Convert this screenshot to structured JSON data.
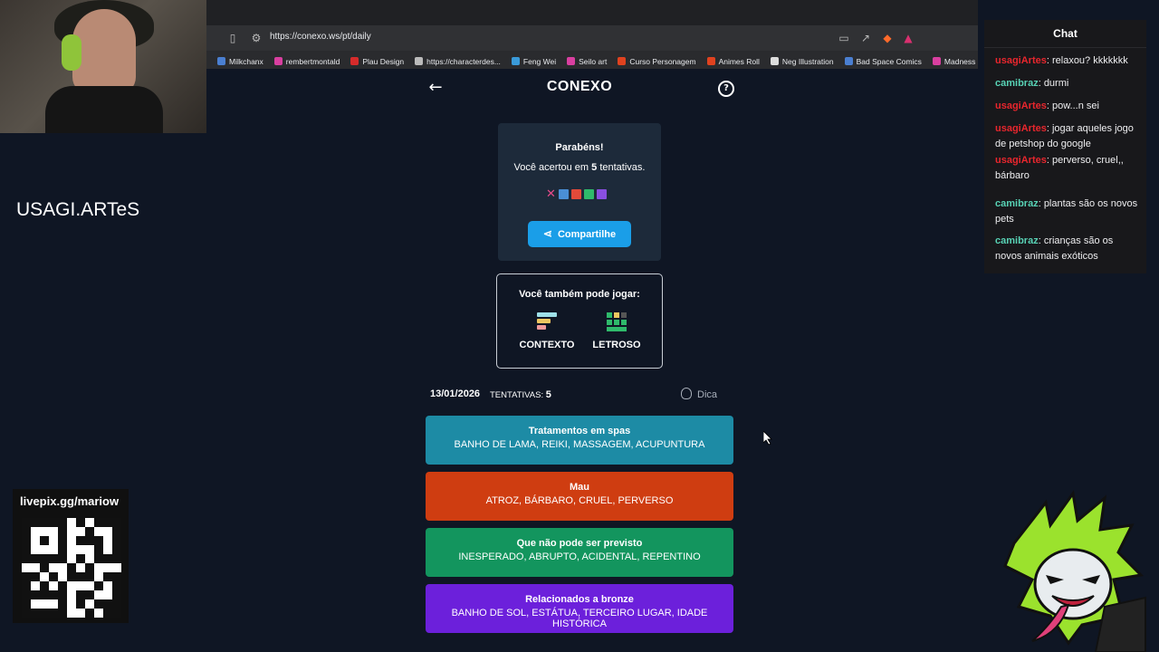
{
  "browser": {
    "url": "https://conexo.ws/pt/daily",
    "bookmarks": [
      {
        "label": "Milkchanx",
        "color": "#4a7fd1"
      },
      {
        "label": "rembertmontald",
        "color": "#d93fa0"
      },
      {
        "label": "Plau Design",
        "color": "#d62b2b"
      },
      {
        "label": "https://characterdes...",
        "color": "#bbbbbb"
      },
      {
        "label": "Feng Wei",
        "color": "#3a9ad9"
      },
      {
        "label": "Seilo art",
        "color": "#d93fa0"
      },
      {
        "label": "Curso Personagem",
        "color": "#e0421f"
      },
      {
        "label": "Animes Roll",
        "color": "#e0421f"
      },
      {
        "label": "Neg Illustration",
        "color": "#dddddd"
      },
      {
        "label": "Bad Space Comics",
        "color": "#4a7fd1"
      },
      {
        "label": "Madness Ma",
        "color": "#d93fa0"
      }
    ]
  },
  "overlay": {
    "channel_name": "USAGI.ARTeS",
    "qr_label": "livepix.gg/mariow"
  },
  "chat": {
    "title": "Chat",
    "messages": [
      {
        "user": "usagiArtes",
        "text": ": relaxou? kkkkkkk",
        "color": "#e8262d"
      },
      {
        "user": "camibraz",
        "text": ": durmi",
        "color": "#58d2b5"
      },
      {
        "user": "usagiArtes",
        "text": ": pow...n sei",
        "color": "#e8262d"
      },
      {
        "user": "usagiArtes",
        "text": ": jogar aqueles jogo de petshop do google",
        "color": "#e8262d"
      },
      {
        "user": "usagiArtes",
        "text": ": perverso, cruel,, bárbaro",
        "color": "#e8262d"
      },
      {
        "user": "camibraz",
        "text": ": plantas são os novos pets",
        "color": "#58d2b5"
      },
      {
        "user": "camibraz",
        "text": ": crianças são os novos animais exóticos",
        "color": "#58d2b5"
      }
    ]
  },
  "game": {
    "title": "CONEXO",
    "congrats": "Parabéns!",
    "attempt_prefix": "Você acertou em ",
    "attempt_count": "5",
    "attempt_suffix": " tentativas.",
    "history": [
      "wrong",
      "#4a8fd6",
      "#e34a3a",
      "#2fba6b",
      "#8a4fe0"
    ],
    "wrong_mark": "✕",
    "share_label": "Compartilhe",
    "more_title": "Você também pode jogar:",
    "other_games": [
      "CONTEXTO",
      "LETROSO"
    ],
    "date": "13/01/2026",
    "attempts_label": "TENTATIVAS:",
    "attempts": "5",
    "hint_label": "Dica",
    "groups": [
      {
        "title": "Tratamentos em spas",
        "words": "BANHO DE LAMA, REIKI, MASSAGEM, ACUPUNTURA",
        "color": "#1d8ba5"
      },
      {
        "title": "Mau",
        "words": "ATROZ, BÁRBARO, CRUEL, PERVERSO",
        "color": "#cf3d11"
      },
      {
        "title": "Que não pode ser previsto",
        "words": "INESPERADO, ABRUPTO, ACIDENTAL, REPENTINO",
        "color": "#13955e"
      },
      {
        "title": "Relacionados a bronze",
        "words": "BANHO DE SOL, ESTÁTUA, TERCEIRO LUGAR, IDADE HISTÓRICA",
        "color": "#6c20db"
      }
    ]
  }
}
